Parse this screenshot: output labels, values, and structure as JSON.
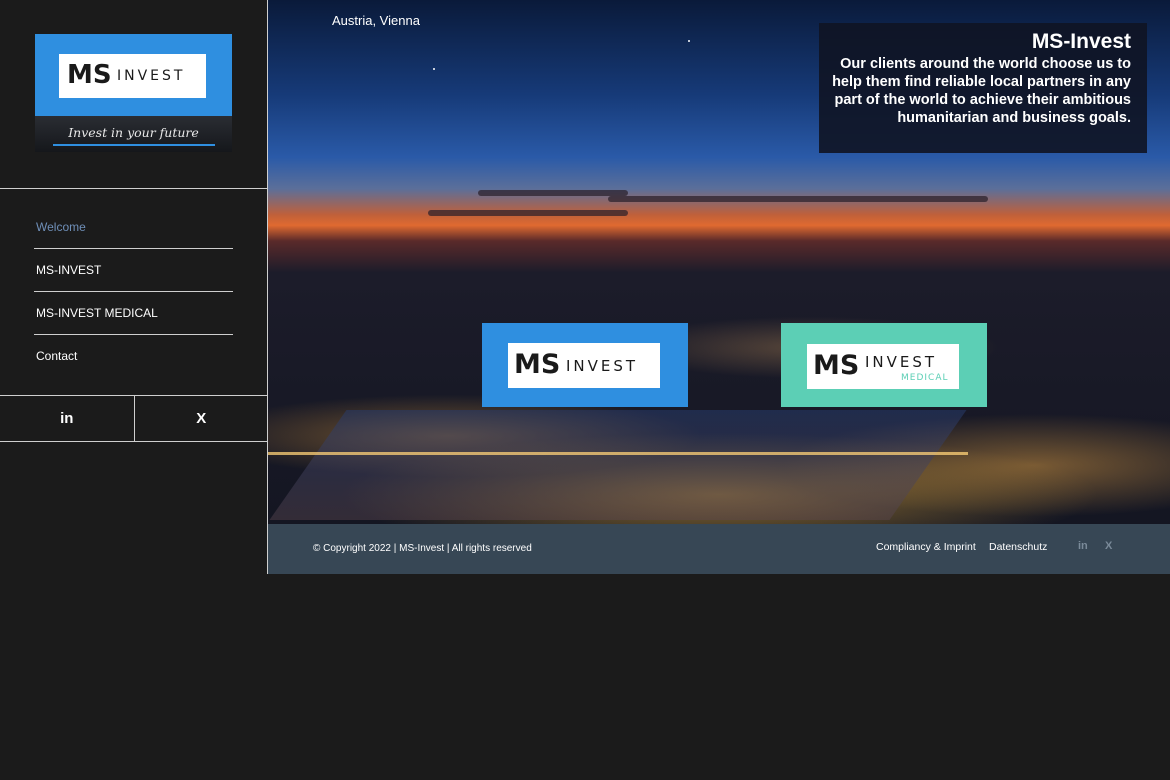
{
  "brand": {
    "logo_mark": "MS",
    "logo_word": "INVEST",
    "tagline": "Invest in your future",
    "medical_word": "MEDICAL"
  },
  "nav": {
    "items": [
      {
        "label": "Welcome",
        "active": true
      },
      {
        "label": "MS-INVEST",
        "active": false
      },
      {
        "label": "MS-INVEST MEDICAL",
        "active": false
      },
      {
        "label": "Contact",
        "active": false
      }
    ]
  },
  "social": {
    "linkedin": "in",
    "xing": "X",
    "linkedin_icon": "linkedin-icon",
    "xing_icon": "xing-icon"
  },
  "hero": {
    "location": "Austria, Vienna",
    "info_title": "MS-Invest",
    "info_text": "Our clients around the world choose us to help them find reliable local partners in any part of the world to achieve their ambitious humanitarian and business goals."
  },
  "footer": {
    "copyright": "© Copyright 2022 | MS-Invest | All rights reserved",
    "link_imprint": "Compliancy & Imprint",
    "link_privacy": "Datenschutz",
    "linkedin": "in",
    "xing": "X"
  },
  "colors": {
    "brand_blue": "#2f8fe0",
    "brand_teal": "#5ccfb5",
    "footer_bg": "#374755",
    "nav_active": "#6f8fb8"
  }
}
